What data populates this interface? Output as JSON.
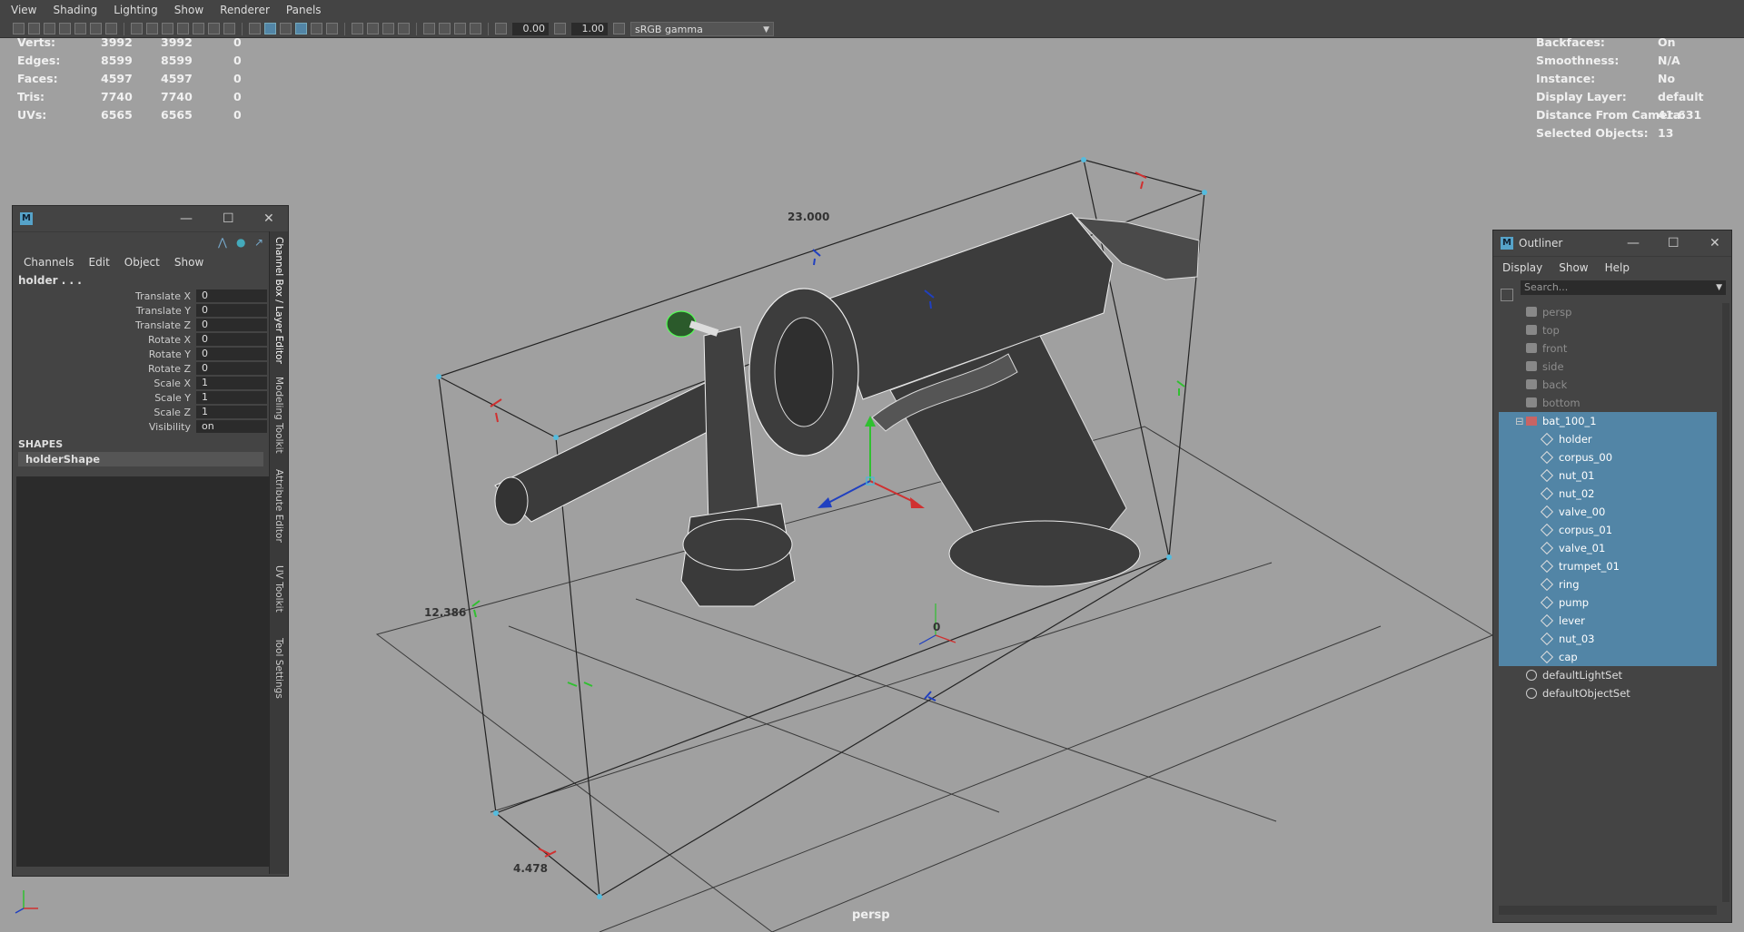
{
  "menubar": {
    "items": [
      "View",
      "Shading",
      "Lighting",
      "Show",
      "Renderer",
      "Panels"
    ]
  },
  "toolbar": {
    "exposure": "0.00",
    "gamma": "1.00",
    "color_space": "sRGB gamma"
  },
  "hud_left": {
    "rows": [
      {
        "label": "Verts:",
        "a": "3992",
        "b": "3992",
        "c": "0"
      },
      {
        "label": "Edges:",
        "a": "8599",
        "b": "8599",
        "c": "0"
      },
      {
        "label": "Faces:",
        "a": "4597",
        "b": "4597",
        "c": "0"
      },
      {
        "label": "Tris:",
        "a": "7740",
        "b": "7740",
        "c": "0"
      },
      {
        "label": "UVs:",
        "a": "6565",
        "b": "6565",
        "c": "0"
      }
    ]
  },
  "hud_right": {
    "rows": [
      {
        "label": "Backfaces:",
        "value": "On"
      },
      {
        "label": "Smoothness:",
        "value": "N/A"
      },
      {
        "label": "Instance:",
        "value": "No"
      },
      {
        "label": "Display Layer:",
        "value": "default"
      },
      {
        "label": "Distance From Camera:",
        "value": "41.631"
      },
      {
        "label": "Selected Objects:",
        "value": "13"
      }
    ]
  },
  "viewport": {
    "dim_width": "23.000",
    "dim_height": "12.386",
    "dim_depth": "4.478",
    "pivot_label": "0",
    "camera": "persp",
    "axis_x": "x",
    "axis_y": "y",
    "axis_z": "z"
  },
  "channel_box": {
    "title_icon": "M",
    "menu": [
      "Channels",
      "Edit",
      "Object",
      "Show"
    ],
    "object_name": "holder . . .",
    "channels": [
      {
        "label": "Translate X",
        "value": "0"
      },
      {
        "label": "Translate Y",
        "value": "0"
      },
      {
        "label": "Translate Z",
        "value": "0"
      },
      {
        "label": "Rotate X",
        "value": "0"
      },
      {
        "label": "Rotate Y",
        "value": "0"
      },
      {
        "label": "Rotate Z",
        "value": "0"
      },
      {
        "label": "Scale X",
        "value": "1"
      },
      {
        "label": "Scale Y",
        "value": "1"
      },
      {
        "label": "Scale Z",
        "value": "1"
      },
      {
        "label": "Visibility",
        "value": "on"
      }
    ],
    "shapes_header": "SHAPES",
    "shape_name": "holderShape",
    "side_tabs": [
      "Channel Box / Layer Editor",
      "Modeling Toolkit",
      "Attribute Editor",
      "UV Toolkit",
      "Tool Settings"
    ]
  },
  "outliner": {
    "title": "Outliner",
    "menu": [
      "Display",
      "Show",
      "Help"
    ],
    "search_placeholder": "Search...",
    "items": [
      {
        "name": "persp",
        "type": "camera",
        "level": 1,
        "selected": false,
        "dim": true
      },
      {
        "name": "top",
        "type": "camera",
        "level": 1,
        "selected": false,
        "dim": true
      },
      {
        "name": "front",
        "type": "camera",
        "level": 1,
        "selected": false,
        "dim": true
      },
      {
        "name": "side",
        "type": "camera",
        "level": 1,
        "selected": false,
        "dim": true
      },
      {
        "name": "back",
        "type": "camera",
        "level": 1,
        "selected": false,
        "dim": true
      },
      {
        "name": "bottom",
        "type": "camera",
        "level": 1,
        "selected": false,
        "dim": true
      },
      {
        "name": "bat_100_1",
        "type": "group",
        "level": 1,
        "selected": true,
        "dim": false
      },
      {
        "name": "holder",
        "type": "mesh",
        "level": 2,
        "selected": true,
        "dim": false
      },
      {
        "name": "corpus_00",
        "type": "mesh",
        "level": 2,
        "selected": true,
        "dim": false
      },
      {
        "name": "nut_01",
        "type": "mesh",
        "level": 2,
        "selected": true,
        "dim": false
      },
      {
        "name": "nut_02",
        "type": "mesh",
        "level": 2,
        "selected": true,
        "dim": false
      },
      {
        "name": "valve_00",
        "type": "mesh",
        "level": 2,
        "selected": true,
        "dim": false
      },
      {
        "name": "corpus_01",
        "type": "mesh",
        "level": 2,
        "selected": true,
        "dim": false
      },
      {
        "name": "valve_01",
        "type": "mesh",
        "level": 2,
        "selected": true,
        "dim": false
      },
      {
        "name": "trumpet_01",
        "type": "mesh",
        "level": 2,
        "selected": true,
        "dim": false
      },
      {
        "name": "ring",
        "type": "mesh",
        "level": 2,
        "selected": true,
        "dim": false
      },
      {
        "name": "pump",
        "type": "mesh",
        "level": 2,
        "selected": true,
        "dim": false
      },
      {
        "name": "lever",
        "type": "mesh",
        "level": 2,
        "selected": true,
        "dim": false
      },
      {
        "name": "nut_03",
        "type": "mesh",
        "level": 2,
        "selected": true,
        "dim": false
      },
      {
        "name": "cap",
        "type": "mesh",
        "level": 2,
        "selected": true,
        "dim": false
      },
      {
        "name": "defaultLightSet",
        "type": "set",
        "level": 1,
        "selected": false,
        "dim": false
      },
      {
        "name": "defaultObjectSet",
        "type": "set",
        "level": 1,
        "selected": false,
        "dim": false
      }
    ]
  },
  "colors": {
    "selection": "#5285a6",
    "panel": "#444444",
    "viewport_bg": "#a0a0a0",
    "manip_x": "#d03030",
    "manip_y": "#30c030",
    "manip_z": "#2040c0"
  }
}
